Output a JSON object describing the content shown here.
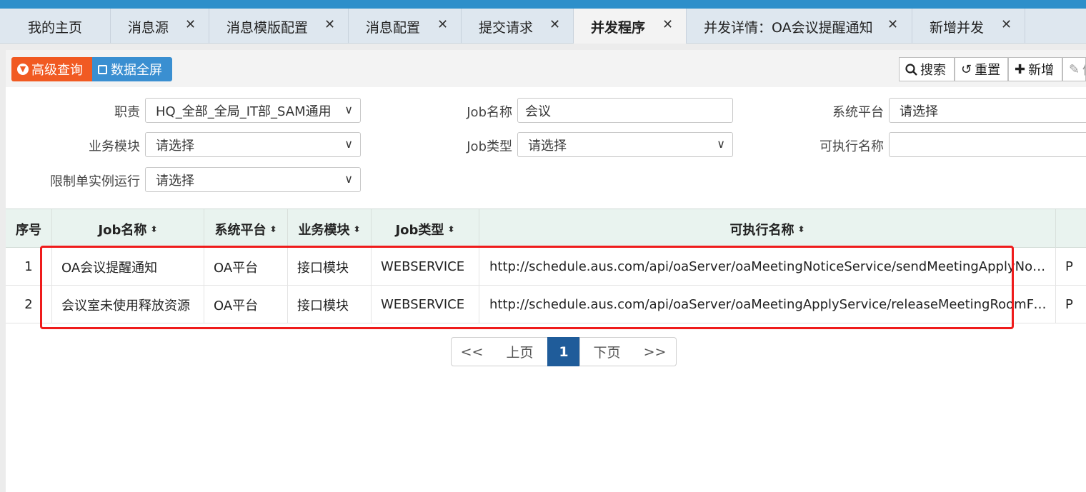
{
  "tabs": [
    {
      "label": "我的主页",
      "closable": false
    },
    {
      "label": "消息源",
      "closable": true
    },
    {
      "label": "消息模版配置",
      "closable": true
    },
    {
      "label": "消息配置",
      "closable": true
    },
    {
      "label": "提交请求",
      "closable": true
    },
    {
      "label": "并发程序",
      "closable": true,
      "active": true
    },
    {
      "label": "并发详情：OA会议提醒通知",
      "closable": true
    },
    {
      "label": "新增并发",
      "closable": true
    }
  ],
  "close_glyph": "✕",
  "toolbar": {
    "advanced_query": "高级查询",
    "fullscreen": "数据全屏",
    "search": "搜索",
    "reset": "重置",
    "add": "新增",
    "edit_partial": "修"
  },
  "filters": {
    "duty_label": "职责",
    "duty_value": "HQ_全部_全局_IT部_SAM通用",
    "jobname_label": "Job名称",
    "jobname_value": "会议",
    "platform_label": "系统平台",
    "platform_value": "请选择",
    "module_label": "业务模块",
    "module_value": "请选择",
    "jobtype_label": "Job类型",
    "jobtype_value": "请选择",
    "exec_label": "可执行名称",
    "exec_value": "",
    "single_label": "限制单实例运行",
    "single_value": "请选择"
  },
  "table": {
    "headers": [
      "序号",
      "Job名称",
      "系统平台",
      "业务模块",
      "Job类型",
      "可执行名称"
    ],
    "rows": [
      {
        "no": "1",
        "job_name": "OA会议提醒通知",
        "platform": "OA平台",
        "module": "接口模块",
        "job_type": "WEBSERVICE",
        "exec": "http://schedule.aus.com/api/oaServer/oaMeetingNoticeService/sendMeetingApplyNotice",
        "extra": "P"
      },
      {
        "no": "2",
        "job_name": "会议室未使用释放资源",
        "platform": "OA平台",
        "module": "接口模块",
        "job_type": "WEBSERVICE",
        "exec": "http://schedule.aus.com/api/oaServer/oaMeetingApplyService/releaseMeetingRoomForLateUse",
        "extra": "P"
      }
    ]
  },
  "pagination": {
    "first": "<<",
    "prev": "上页",
    "current": "1",
    "next": "下页",
    "last": ">>"
  },
  "colors": {
    "topbar": "#2d8fca",
    "orange_button": "#f15a22",
    "blue_button": "#3a8fd1",
    "highlight_box": "#ef1b1b",
    "active_page": "#1f5c9a"
  }
}
